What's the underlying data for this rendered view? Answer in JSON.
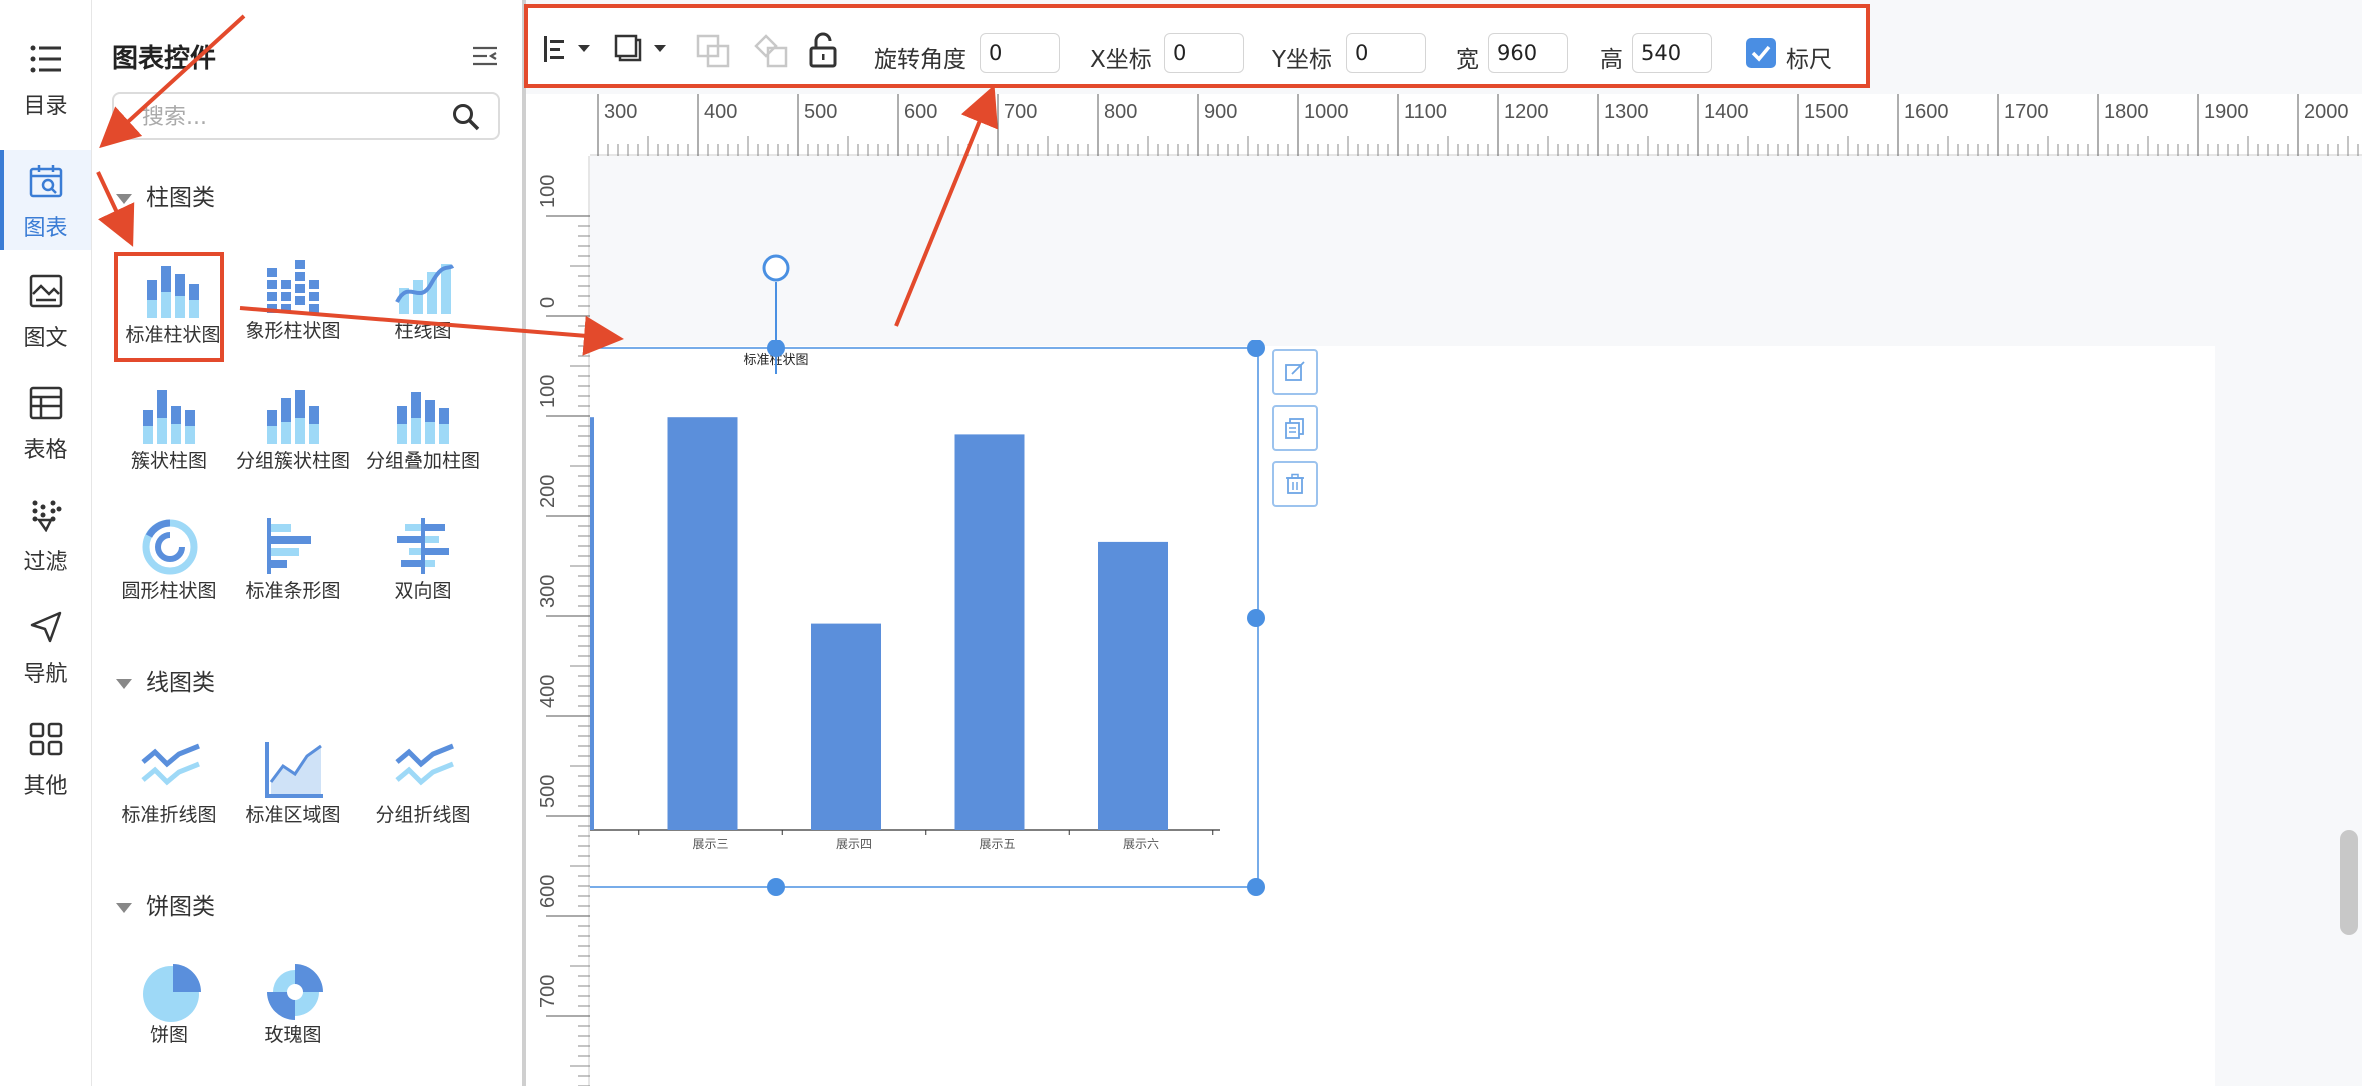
{
  "nav": {
    "items": [
      {
        "label": "目录",
        "icon": "list-icon"
      },
      {
        "label": "图表",
        "icon": "chart-calendar-icon",
        "active": true
      },
      {
        "label": "图文",
        "icon": "image-text-icon"
      },
      {
        "label": "表格",
        "icon": "table-icon"
      },
      {
        "label": "过滤",
        "icon": "filter-icon"
      },
      {
        "label": "导航",
        "icon": "navigation-icon"
      },
      {
        "label": "其他",
        "icon": "grid-icon"
      }
    ]
  },
  "panel": {
    "title": "图表控件",
    "search_placeholder": "搜索...",
    "categories": [
      {
        "name": "柱图类",
        "items": [
          "标准柱状图",
          "象形柱状图",
          "柱线图",
          "簇状柱图",
          "分组簇状柱图",
          "分组叠加柱图",
          "圆形柱状图",
          "标准条形图",
          "双向图"
        ]
      },
      {
        "name": "线图类",
        "items": [
          "标准折线图",
          "标准区域图",
          "分组折线图"
        ]
      },
      {
        "name": "饼图类",
        "items": [
          "饼图",
          "玫瑰图"
        ]
      }
    ]
  },
  "toolbar": {
    "rotation_label": "旋转角度",
    "rotation_value": "0",
    "x_label": "X坐标",
    "x_value": "0",
    "y_label": "Y坐标",
    "y_value": "0",
    "width_label": "宽",
    "width_value": "960",
    "height_label": "高",
    "height_value": "540",
    "ruler_label": "标尺",
    "ruler_checked": true
  },
  "rulers": {
    "horizontal_ticks": [
      "300",
      "400",
      "500",
      "600",
      "700",
      "800",
      "900",
      "1000",
      "1100",
      "1200",
      "1300",
      "1400",
      "1500",
      "1600",
      "1700",
      "1800",
      "1900",
      "2000"
    ],
    "vertical_ticks": [
      "100",
      "0",
      "100",
      "200",
      "300",
      "400",
      "500",
      "600",
      "700"
    ]
  },
  "chart_data": {
    "type": "bar",
    "title": "标准柱状图",
    "categories": [
      "",
      "",
      "展示三",
      "展示四",
      "展示五",
      "展示六"
    ],
    "values": [
      96,
      96,
      48,
      92,
      67
    ],
    "bar_color": "#5b8fdb"
  },
  "colors": {
    "accent": "#3a7cd5",
    "annotation": "#e34a2c",
    "selection": "#4a90e2"
  }
}
